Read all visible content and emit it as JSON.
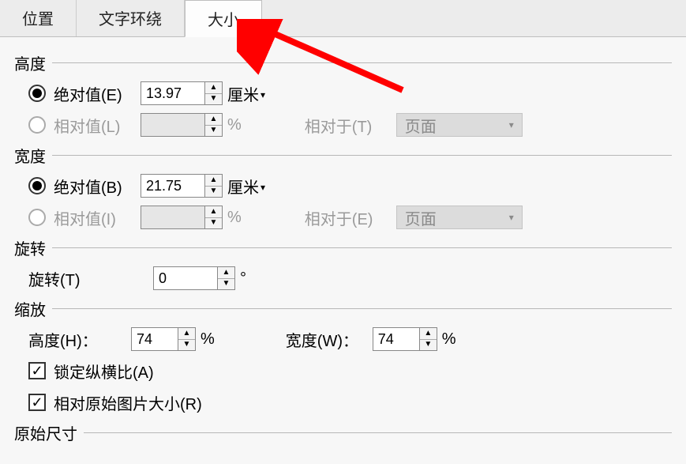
{
  "tabs": {
    "pos": "位置",
    "wrap": "文字环绕",
    "size": "大小"
  },
  "height": {
    "title": "高度",
    "abs_label": "绝对值(E)",
    "abs_value": "13.97",
    "abs_unit": "厘米",
    "rel_label": "相对值(L)",
    "rel_value": "",
    "rel_unit": "%",
    "rel_to_label": "相对于(T)",
    "rel_to_value": "页面"
  },
  "width": {
    "title": "宽度",
    "abs_label": "绝对值(B)",
    "abs_value": "21.75",
    "abs_unit": "厘米",
    "rel_label": "相对值(I)",
    "rel_value": "",
    "rel_unit": "%",
    "rel_to_label": "相对于(E)",
    "rel_to_value": "页面"
  },
  "rotation": {
    "title": "旋转",
    "label": "旋转(T)",
    "value": "0",
    "unit": "°"
  },
  "scale": {
    "title": "缩放",
    "h_label": "高度(H)：",
    "h_value": "74",
    "h_unit": "%",
    "w_label": "宽度(W)：",
    "w_value": "74",
    "w_unit": "%",
    "lock_label": "锁定纵横比(A)",
    "orig_label": "相对原始图片大小(R)"
  },
  "original": {
    "title": "原始尺寸"
  }
}
